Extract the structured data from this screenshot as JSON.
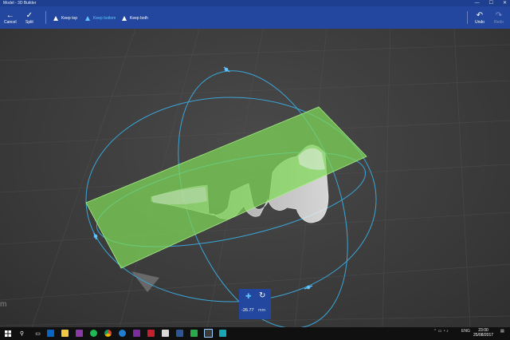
{
  "window": {
    "title": "Model - 3D Builder",
    "controls": [
      "—",
      "☐",
      "✕"
    ]
  },
  "toolbar": {
    "cancel_label": "Cancel",
    "split_label": "Split",
    "keep_top_label": "Keep top",
    "keep_bottom_label": "Keep bottom",
    "keep_both_label": "Keep both",
    "undo_label": "Undo",
    "redo_label": "Redo",
    "selected_option": "Keep bottom"
  },
  "viewport": {
    "edge_text": "m"
  },
  "offset_panel": {
    "value": "-26.77",
    "unit": "mm"
  },
  "taskbar": {
    "apps": [
      "start",
      "search",
      "outlook",
      "file-explorer",
      "onenote",
      "spotify",
      "chrome",
      "edge",
      "onenote-2",
      "acrobat",
      "pdf",
      "word",
      "photos",
      "3d-builder",
      "app"
    ],
    "language": "ENG",
    "time": "23:00",
    "date": "25/08/2017"
  },
  "colors": {
    "accent": "#23479e",
    "active": "#5fc4ff",
    "plane": "#7ed957"
  }
}
